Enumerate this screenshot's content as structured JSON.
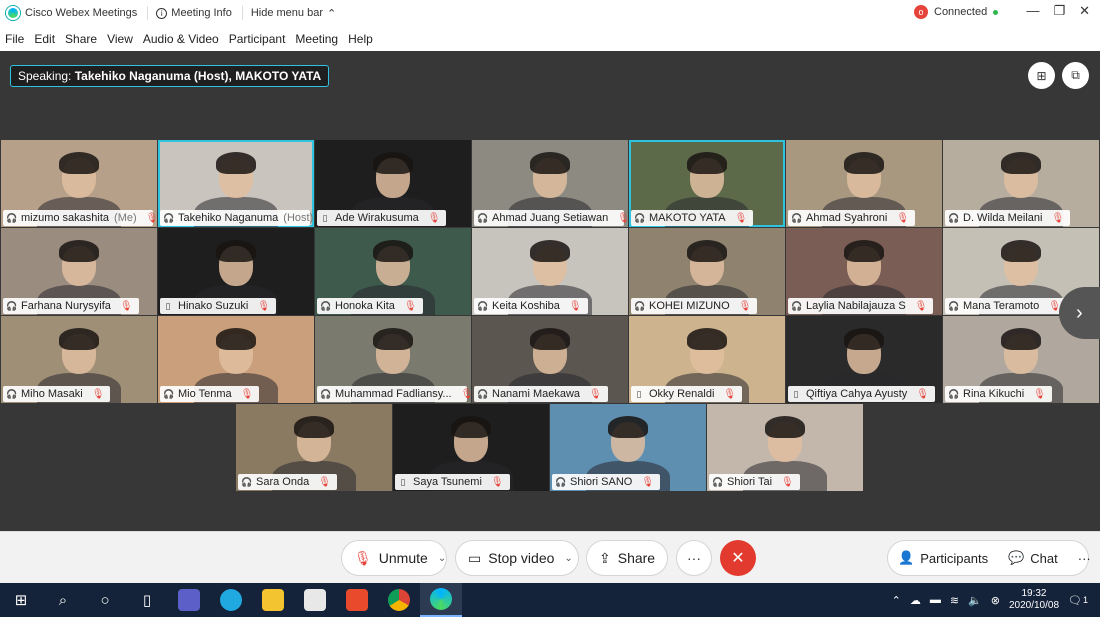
{
  "titlebar": {
    "app_title": "Cisco Webex Meetings",
    "meeting_info": "Meeting Info",
    "hide_menu": "Hide menu bar",
    "status": "Connected",
    "status_color": "#2db84d"
  },
  "menu": [
    "File",
    "Edit",
    "Share",
    "View",
    "Audio & Video",
    "Participant",
    "Meeting",
    "Help"
  ],
  "speaking": {
    "label": "Speaking:",
    "names": "Takehiko Naganuma (Host), MAKOTO YATA"
  },
  "participants": [
    {
      "name": "mizumo sakashita",
      "tag": "(Me)",
      "device": "headset",
      "bg": "#b6a08a"
    },
    {
      "name": "Takehiko Naganuma",
      "tag": "(Host)",
      "device": "headset",
      "bg": "#c9c4bd",
      "active": true
    },
    {
      "name": "Ade Wirakusuma",
      "tag": "",
      "device": "phone",
      "bg": "#1e1e1e"
    },
    {
      "name": "Ahmad Juang Setiawan",
      "tag": "",
      "device": "headset",
      "bg": "#8d8a82"
    },
    {
      "name": "MAKOTO YATA",
      "tag": "",
      "device": "headset",
      "bg": "#5d6a4a",
      "active": true
    },
    {
      "name": "Ahmad Syahroni",
      "tag": "",
      "device": "headset",
      "bg": "#a89880"
    },
    {
      "name": "D. Wilda Meilani",
      "tag": "",
      "device": "headset",
      "bg": "#b7ad9f"
    },
    {
      "name": "Farhana Nurysyifa",
      "tag": "",
      "device": "headset",
      "bg": "#9b8c80"
    },
    {
      "name": "Hinako Suzuki",
      "tag": "",
      "device": "phone",
      "bg": "#1e1e1e"
    },
    {
      "name": "Honoka Kita",
      "tag": "",
      "device": "headset",
      "bg": "#3e5a4c"
    },
    {
      "name": "Keita Koshiba",
      "tag": "",
      "device": "headset",
      "bg": "#c7c3bd"
    },
    {
      "name": "KOHEI MIZUNO",
      "tag": "",
      "device": "headset",
      "bg": "#8f8370"
    },
    {
      "name": "Laylia Nabilajauza S",
      "tag": "",
      "device": "headset",
      "bg": "#7a5e55"
    },
    {
      "name": "Mana Teramoto",
      "tag": "",
      "device": "headset",
      "bg": "#c5c0b6"
    },
    {
      "name": "Miho Masaki",
      "tag": "",
      "device": "headset",
      "bg": "#a08f77"
    },
    {
      "name": "Mio Tenma",
      "tag": "",
      "device": "headset",
      "bg": "#caa07c"
    },
    {
      "name": "Muhammad Fadliansy...",
      "tag": "",
      "device": "headset",
      "bg": "#7a7a6e"
    },
    {
      "name": "Nanami Maekawa",
      "tag": "",
      "device": "headset",
      "bg": "#5c5650"
    },
    {
      "name": "Okky Renaldi",
      "tag": "",
      "device": "phone",
      "bg": "#cdb48e"
    },
    {
      "name": "Qiftiya Cahya Ayusty",
      "tag": "",
      "device": "phone",
      "bg": "#2a2a2a"
    },
    {
      "name": "Rina Kikuchi",
      "tag": "",
      "device": "headset",
      "bg": "#b0a89e"
    },
    {
      "name": "Sara Onda",
      "tag": "",
      "device": "headset",
      "bg": "#8b7a62"
    },
    {
      "name": "Saya Tsunemi",
      "tag": "",
      "device": "phone",
      "bg": "#1e1e1e"
    },
    {
      "name": "Shiori SANO",
      "tag": "",
      "device": "headset",
      "bg": "#5e8fb0"
    },
    {
      "name": "Shiori Tai",
      "tag": "",
      "device": "headset",
      "bg": "#c3b7ab"
    }
  ],
  "controls": {
    "unmute": "Unmute",
    "stop_video": "Stop video",
    "share": "Share",
    "more": "···",
    "leave": "✕",
    "participants": "Participants",
    "chat": "Chat"
  },
  "taskbar": {
    "time": "19:32",
    "date": "2020/10/08",
    "notifications": "1"
  }
}
